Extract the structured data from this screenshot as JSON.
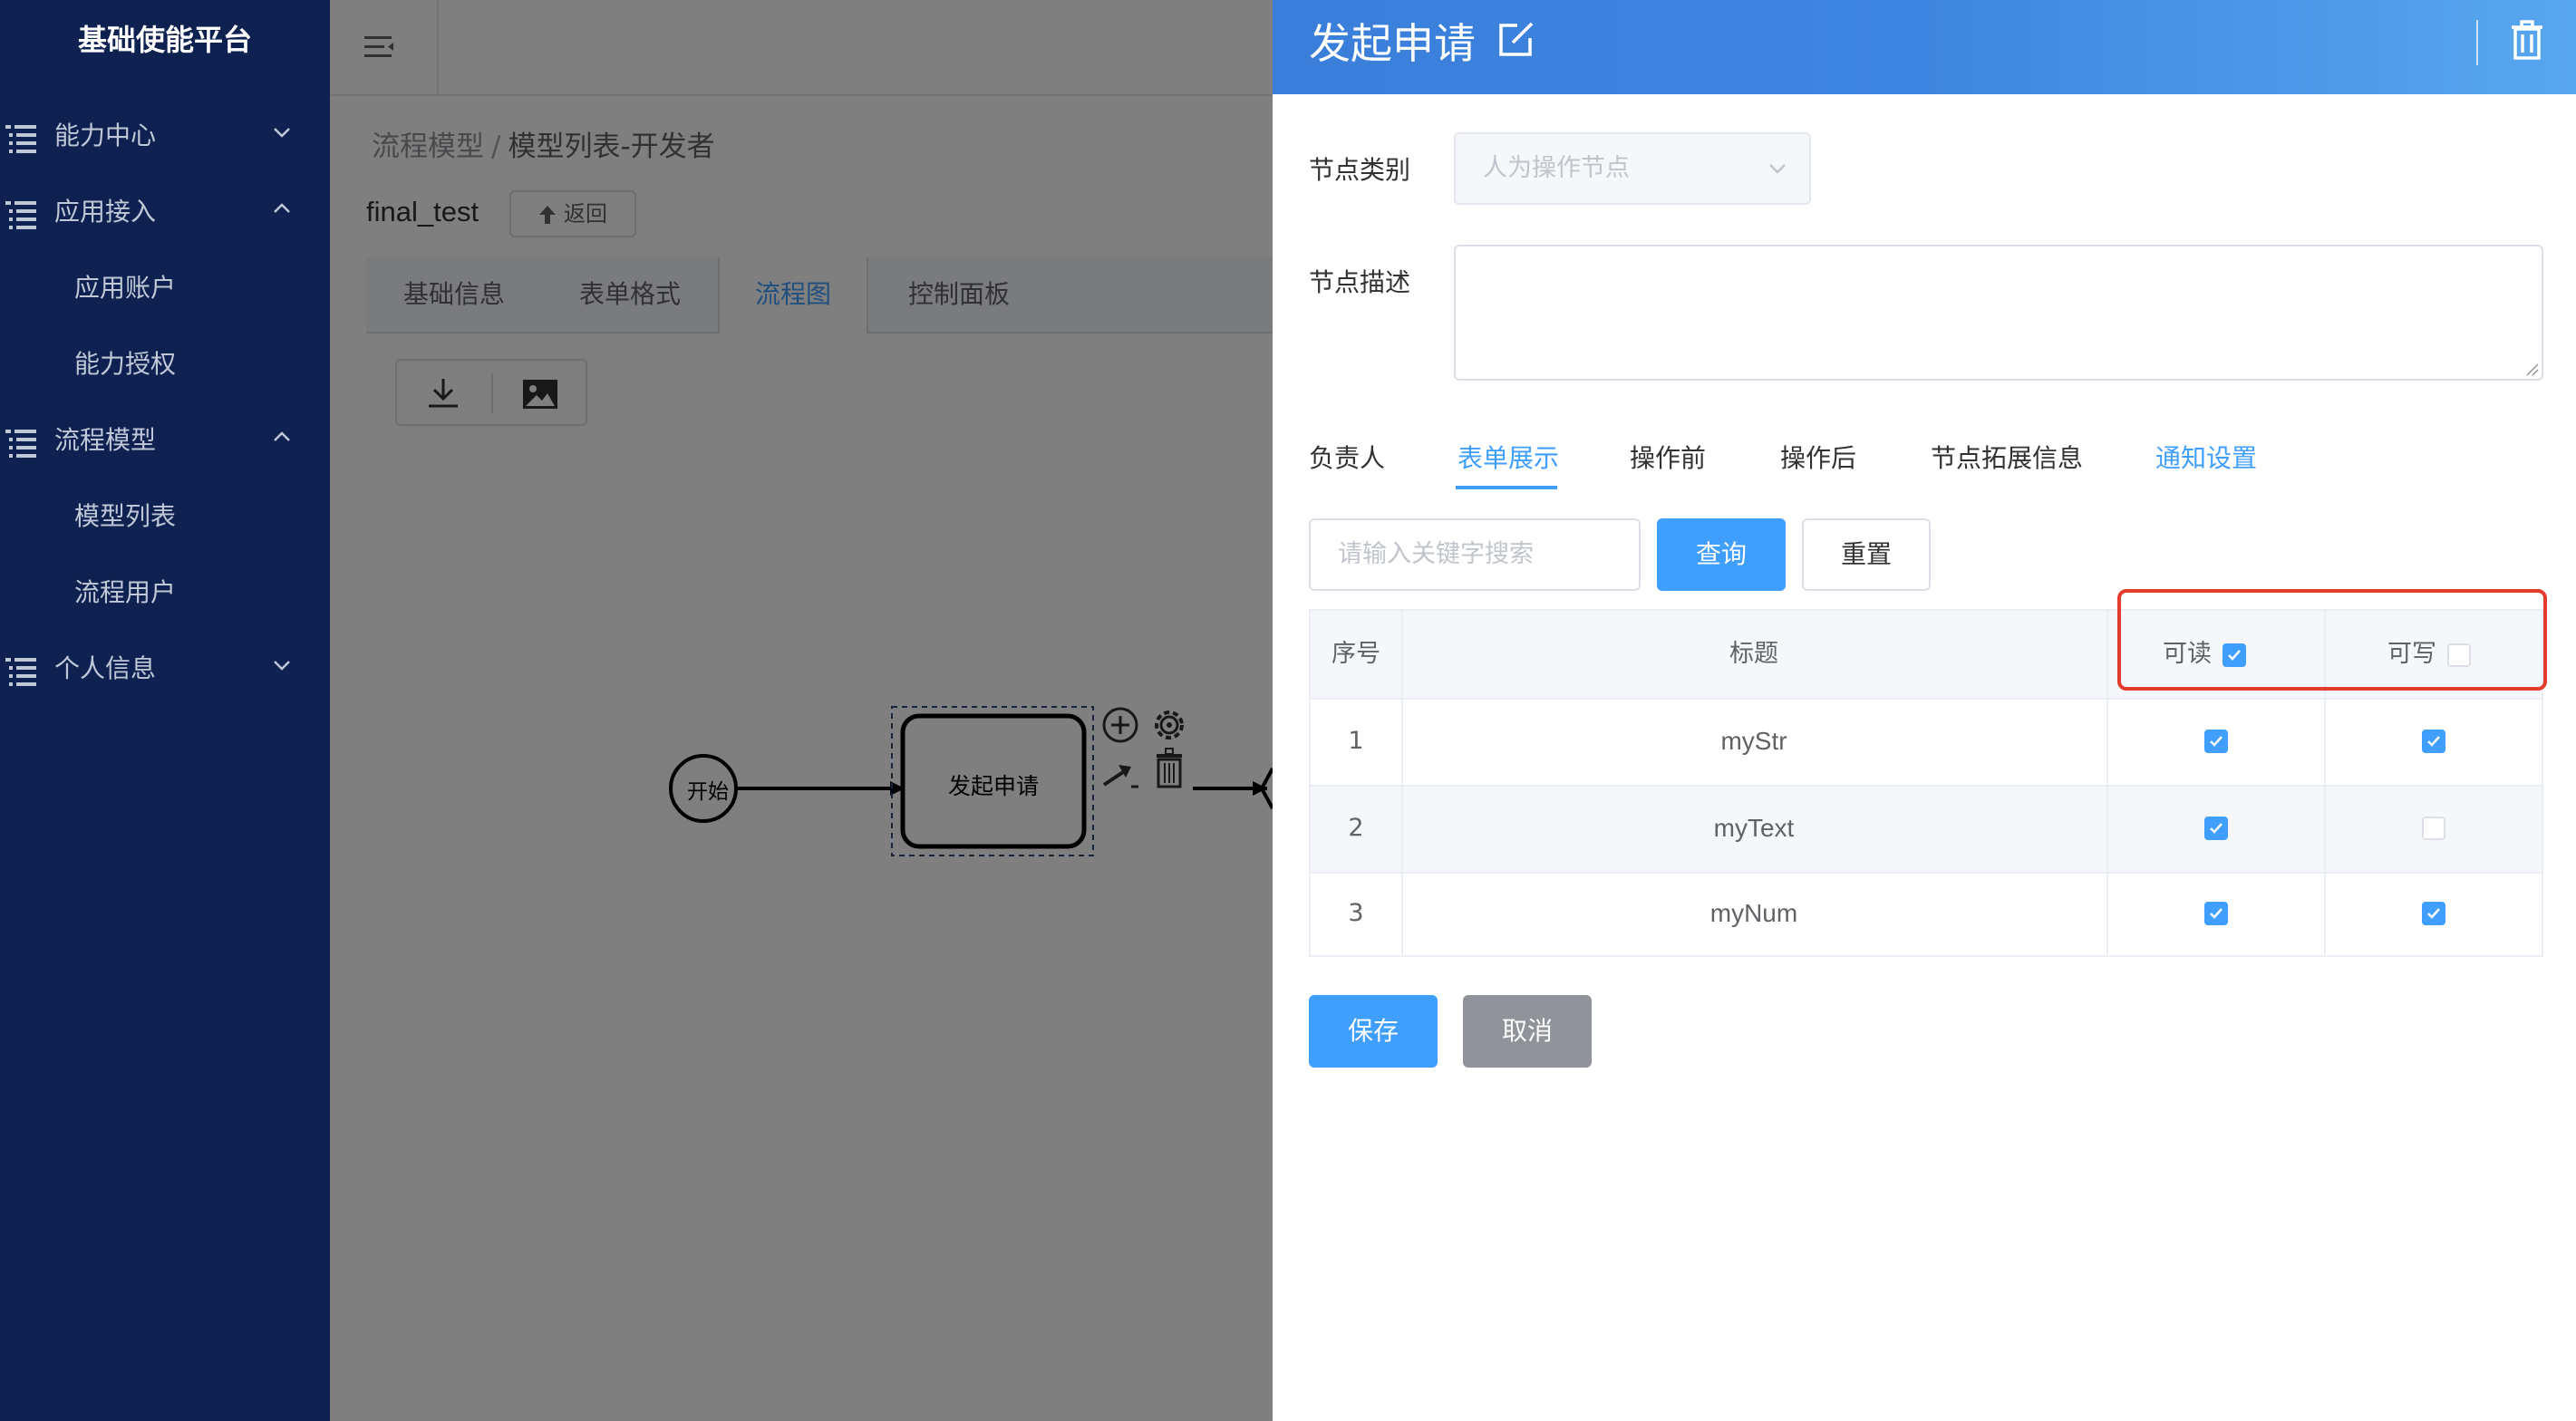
{
  "sidebar": {
    "logo": "基础使能平台",
    "menu": [
      {
        "label": "能力中心",
        "expanded": false
      },
      {
        "label": "应用接入",
        "expanded": true,
        "children": [
          "应用账户",
          "能力授权"
        ]
      },
      {
        "label": "流程模型",
        "expanded": true,
        "children": [
          "模型列表",
          "流程用户"
        ]
      },
      {
        "label": "个人信息",
        "expanded": false
      }
    ]
  },
  "breadcrumb": {
    "parent": "流程模型",
    "separator": "/",
    "current": "模型列表-开发者"
  },
  "model": {
    "name": "final_test",
    "back_label": "返回"
  },
  "tabs": [
    "基础信息",
    "表单格式",
    "流程图",
    "控制面板"
  ],
  "active_tab": "流程图",
  "diagram": {
    "start_label": "开始",
    "task_label": "发起申请"
  },
  "drawer": {
    "title": "发起申请",
    "node_type_label": "节点类别",
    "node_type_value": "人为操作节点",
    "node_desc_label": "节点描述",
    "node_desc_value": "",
    "tabs": [
      "负责人",
      "表单展示",
      "操作前",
      "操作后",
      "节点拓展信息",
      "通知设置"
    ],
    "active_tab": "表单展示",
    "search_placeholder": "请输入关键字搜索",
    "query_label": "查询",
    "reset_label": "重置",
    "table": {
      "headers": {
        "index": "序号",
        "title": "标题",
        "readable": "可读",
        "writable": "可写"
      },
      "header_readable_checked": true,
      "header_writable_checked": false,
      "rows": [
        {
          "index": "1",
          "title": "myStr",
          "readable": true,
          "writable": true
        },
        {
          "index": "2",
          "title": "myText",
          "readable": true,
          "writable": false
        },
        {
          "index": "3",
          "title": "myNum",
          "readable": true,
          "writable": true
        }
      ]
    },
    "save_label": "保存",
    "cancel_label": "取消"
  },
  "colors": {
    "sidebar_bg": "#0e2150",
    "primary": "#409eff",
    "header_gradient_start": "#3a7ed9",
    "highlight": "#e43b2f",
    "cancel": "#909399"
  }
}
